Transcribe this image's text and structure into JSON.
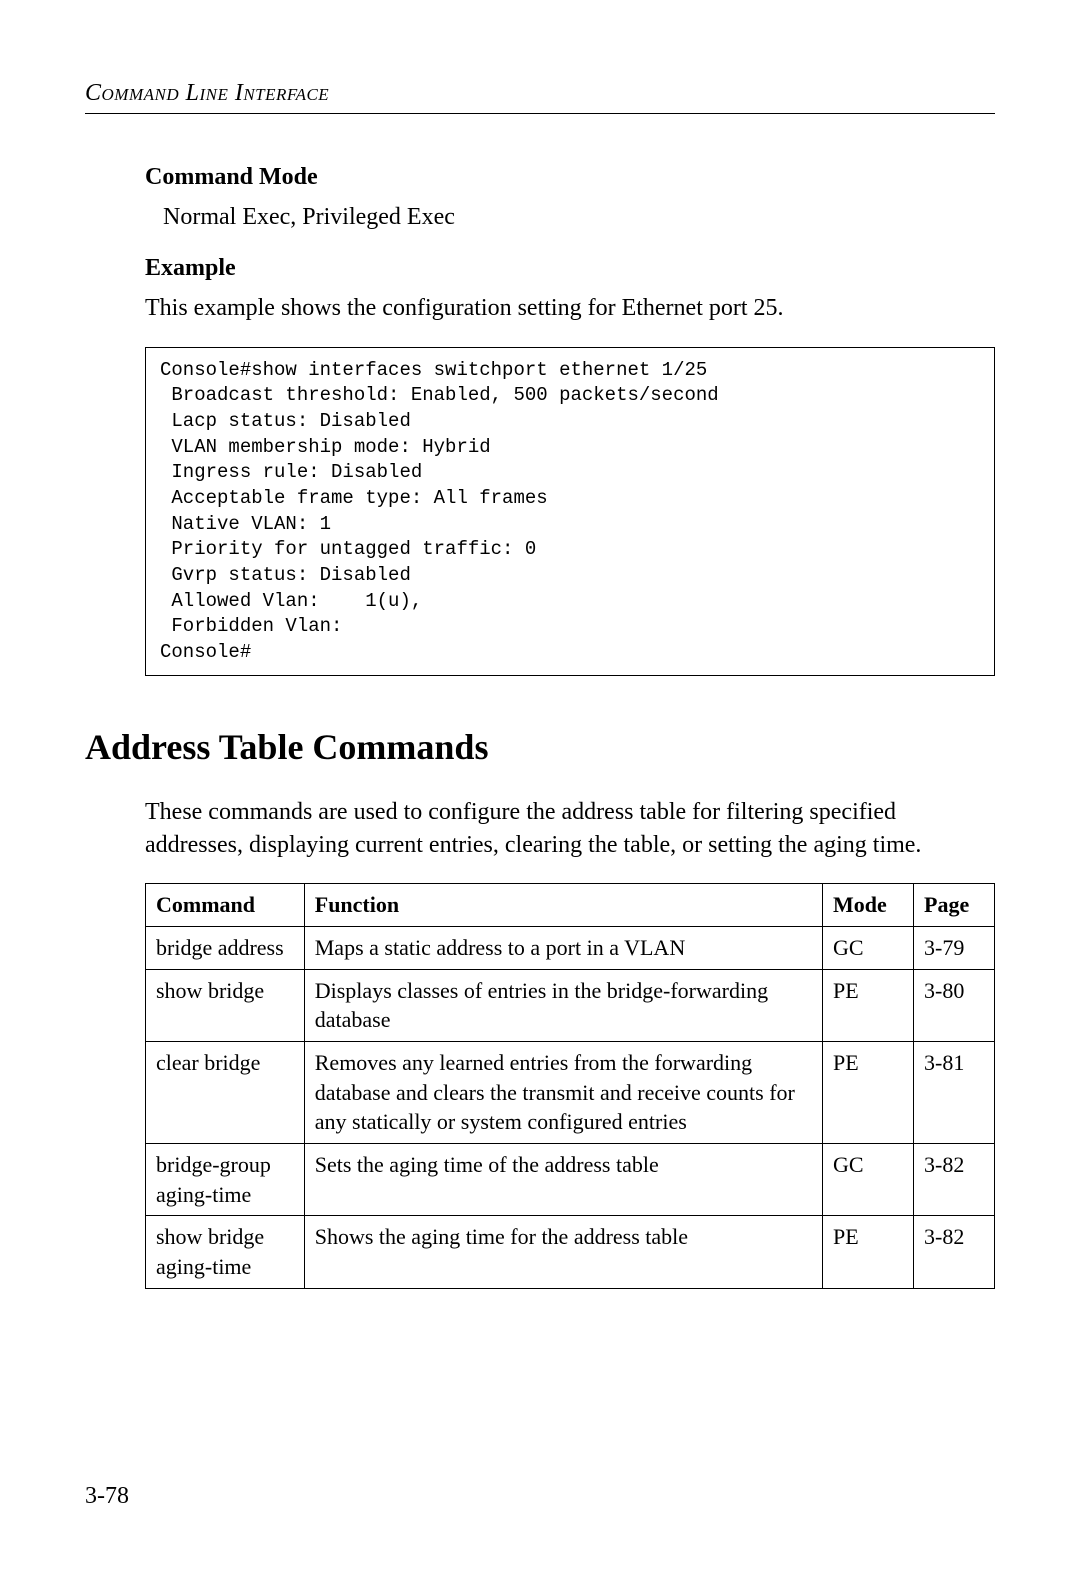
{
  "running_head": "Command Line Interface",
  "command_mode": {
    "heading": "Command Mode",
    "body": "Normal Exec, Privileged Exec"
  },
  "example": {
    "heading": "Example",
    "intro": "This example shows the configuration setting for Ethernet port 25.",
    "code": "Console#show interfaces switchport ethernet 1/25\n Broadcast threshold: Enabled, 500 packets/second\n Lacp status: Disabled\n VLAN membership mode: Hybrid\n Ingress rule: Disabled\n Acceptable frame type: All frames\n Native VLAN: 1\n Priority for untagged traffic: 0\n Gvrp status: Disabled\n Allowed Vlan:    1(u),\n Forbidden Vlan:\nConsole#"
  },
  "section": {
    "title": "Address Table Commands",
    "intro": "These commands are used to configure the address table for filtering specified addresses, displaying current entries, clearing the table, or setting the aging time."
  },
  "table": {
    "headers": {
      "command": "Command",
      "function": "Function",
      "mode": "Mode",
      "page": "Page"
    },
    "rows": [
      {
        "command": "bridge address",
        "function": "Maps a static address to a port in a VLAN",
        "mode": "GC",
        "page": "3-79"
      },
      {
        "command": "show bridge",
        "function": "Displays classes of entries in the bridge-forwarding database",
        "mode": "PE",
        "page": "3-80"
      },
      {
        "command": "clear bridge",
        "function": "Removes any learned entries from the forwarding database and clears the transmit and receive counts for any statically or system configured entries",
        "mode": "PE",
        "page": "3-81"
      },
      {
        "command": "bridge-group aging-time",
        "function": "Sets the aging time of the address table",
        "mode": "GC",
        "page": "3-82"
      },
      {
        "command": "show bridge aging-time",
        "function": "Shows the aging time for the address table",
        "mode": "PE",
        "page": "3-82"
      }
    ]
  },
  "page_number": "3-78"
}
